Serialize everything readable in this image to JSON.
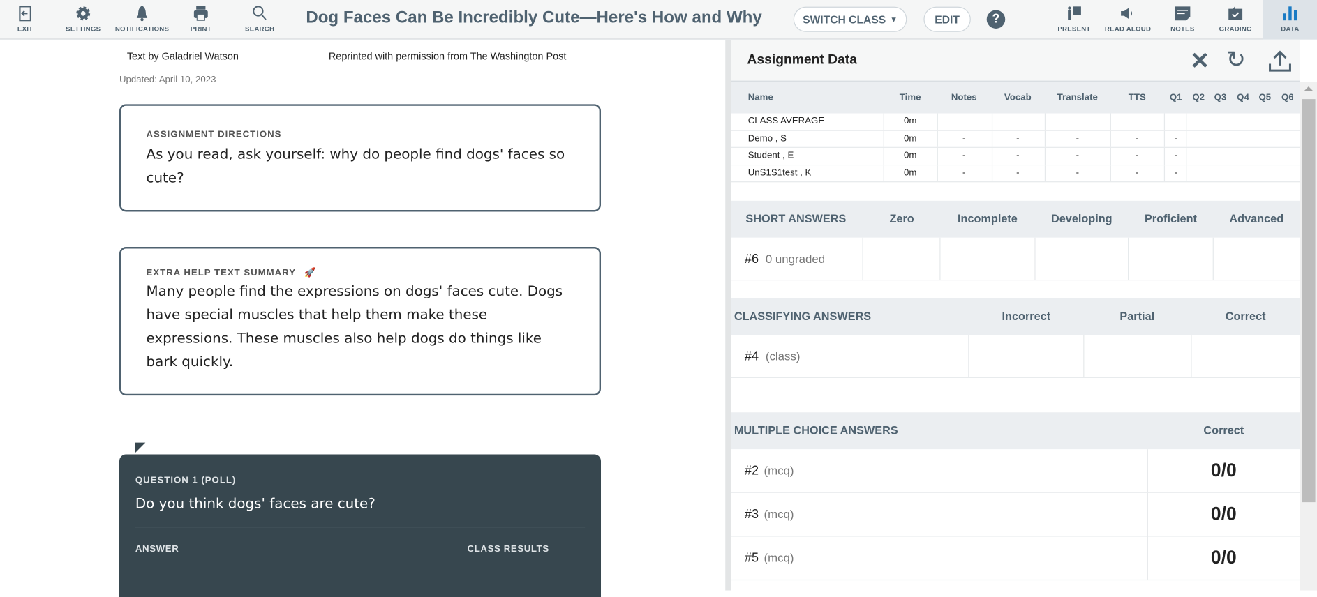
{
  "toolbar": {
    "left": [
      {
        "label": "EXIT",
        "icon": "exit-icon"
      },
      {
        "label": "SETTINGS",
        "icon": "gear-icon"
      },
      {
        "label": "NOTIFICATIONS",
        "icon": "bell-icon"
      },
      {
        "label": "PRINT",
        "icon": "printer-icon"
      },
      {
        "label": "SEARCH",
        "icon": "search-icon"
      }
    ],
    "title": "Dog Faces Can Be Incredibly Cute—Here's How and Why",
    "switch_class": "SWITCH CLASS",
    "edit": "EDIT",
    "help": "?",
    "right": [
      {
        "label": "PRESENT"
      },
      {
        "label": "READ ALOUD"
      },
      {
        "label": "NOTES"
      },
      {
        "label": "GRADING"
      },
      {
        "label": "DATA"
      }
    ]
  },
  "article": {
    "byline": "Text by Galadriel Watson",
    "reprint": "Reprinted with permission from The Washington Post",
    "updated": "Updated: April 10, 2023",
    "directions": {
      "heading": "ASSIGNMENT DIRECTIONS",
      "text": "As you read, ask yourself: why do people find dogs' faces so cute?"
    },
    "summary": {
      "heading": "EXTRA HELP TEXT SUMMARY",
      "text": "Many people find the expressions on dogs' faces cute. Dogs have special muscles that help them make these expressions. These muscles also help dogs do things like bark quickly."
    },
    "question": {
      "label": "QUESTION 1 (POLL)",
      "text": "Do you think dogs' faces are cute?",
      "answer": "ANSWER",
      "results": "CLASS RESULTS"
    }
  },
  "panel": {
    "title": "Assignment Data",
    "columns": [
      "Name",
      "Time",
      "Notes",
      "Vocab",
      "Translate",
      "TTS",
      "Q1",
      "Q2",
      "Q3",
      "Q4",
      "Q5",
      "Q6"
    ],
    "rows": [
      [
        "CLASS AVERAGE",
        "0m",
        "-",
        "-",
        "-",
        "-",
        "-"
      ],
      [
        "Demo , S",
        "0m",
        "-",
        "-",
        "-",
        "-",
        "-"
      ],
      [
        "Student , E",
        "0m",
        "-",
        "-",
        "-",
        "-",
        "-"
      ],
      [
        "UnS1S1test , K",
        "0m",
        "-",
        "-",
        "-",
        "-",
        "-"
      ]
    ],
    "short": {
      "title": "SHORT ANSWERS",
      "cols": [
        "Zero",
        "Incomplete",
        "Developing",
        "Proficient",
        "Advanced"
      ],
      "q": "#6",
      "sub": "0 ungraded"
    },
    "classifying": {
      "title": "CLASSIFYING ANSWERS",
      "cols": [
        "Incorrect",
        "Partial",
        "Correct"
      ],
      "q": "#4",
      "sub": "(class)"
    },
    "mc": {
      "title": "MULTIPLE CHOICE ANSWERS",
      "col": "Correct",
      "rows": [
        {
          "q": "#2",
          "sub": "(mcq)",
          "score": "0/0"
        },
        {
          "q": "#3",
          "sub": "(mcq)",
          "score": "0/0"
        },
        {
          "q": "#5",
          "sub": "(mcq)",
          "score": "0/0"
        }
      ]
    }
  },
  "colors": {
    "accent": "#4f6270",
    "data_blue": "#1a7bc4",
    "dark": "#37474f"
  }
}
